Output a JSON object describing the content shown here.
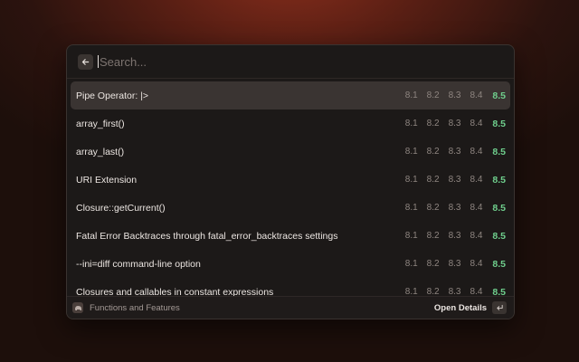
{
  "search": {
    "placeholder": "Search..."
  },
  "features": [
    {
      "label": "Pipe Operator: |>",
      "versions": [
        "8.1",
        "8.2",
        "8.3",
        "8.4"
      ],
      "latest": "8.5",
      "selected": true
    },
    {
      "label": "array_first()",
      "versions": [
        "8.1",
        "8.2",
        "8.3",
        "8.4"
      ],
      "latest": "8.5"
    },
    {
      "label": "array_last()",
      "versions": [
        "8.1",
        "8.2",
        "8.3",
        "8.4"
      ],
      "latest": "8.5"
    },
    {
      "label": "URI Extension",
      "versions": [
        "8.1",
        "8.2",
        "8.3",
        "8.4"
      ],
      "latest": "8.5"
    },
    {
      "label": "Closure::getCurrent()",
      "versions": [
        "8.1",
        "8.2",
        "8.3",
        "8.4"
      ],
      "latest": "8.5"
    },
    {
      "label": "Fatal Error Backtraces through fatal_error_backtraces settings",
      "versions": [
        "8.1",
        "8.2",
        "8.3",
        "8.4"
      ],
      "latest": "8.5"
    },
    {
      "label": "--ini=diff command-line option",
      "versions": [
        "8.1",
        "8.2",
        "8.3",
        "8.4"
      ],
      "latest": "8.5"
    },
    {
      "label": "Closures and callables in constant expressions",
      "versions": [
        "8.1",
        "8.2",
        "8.3",
        "8.4"
      ],
      "latest": "8.5"
    }
  ],
  "footer": {
    "title": "Functions and Features",
    "action": "Open Details"
  },
  "colors": {
    "latest_version": "#6fcf8d",
    "selected_row": "#3a3432",
    "panel": "#1c1918"
  },
  "icons": {
    "back": "arrow-left-icon",
    "app": "php-elephant-icon",
    "enter": "enter-return-icon"
  }
}
